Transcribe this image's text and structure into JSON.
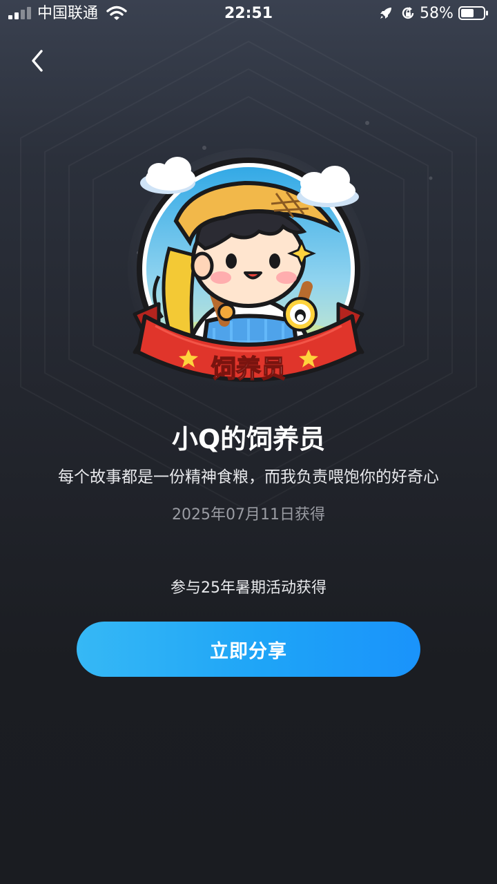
{
  "status_bar": {
    "carrier": "中国联通",
    "time": "22:51",
    "battery_percent": "58%"
  },
  "icons": {
    "back": "chevron-left-icon",
    "signal": "signal-icon",
    "wifi": "wifi-icon",
    "rocket": "rocket-icon",
    "orientation_lock": "orientation-lock-icon",
    "battery": "battery-icon"
  },
  "badge": {
    "banner_text": "饲养员"
  },
  "achievement": {
    "title": "小Q的饲养员",
    "description": "每个故事都是一份精神食粮，而我负责喂饱你的好奇心",
    "date": "2025年07月11日获得",
    "source": "参与25年暑期活动获得"
  },
  "actions": {
    "share_label": "立即分享"
  },
  "colors": {
    "button_start": "#36b8f5",
    "button_end": "#1a93fb",
    "banner_red": "#e0352b",
    "background_top": "#3a4150",
    "background_bottom": "#1a1c21"
  }
}
